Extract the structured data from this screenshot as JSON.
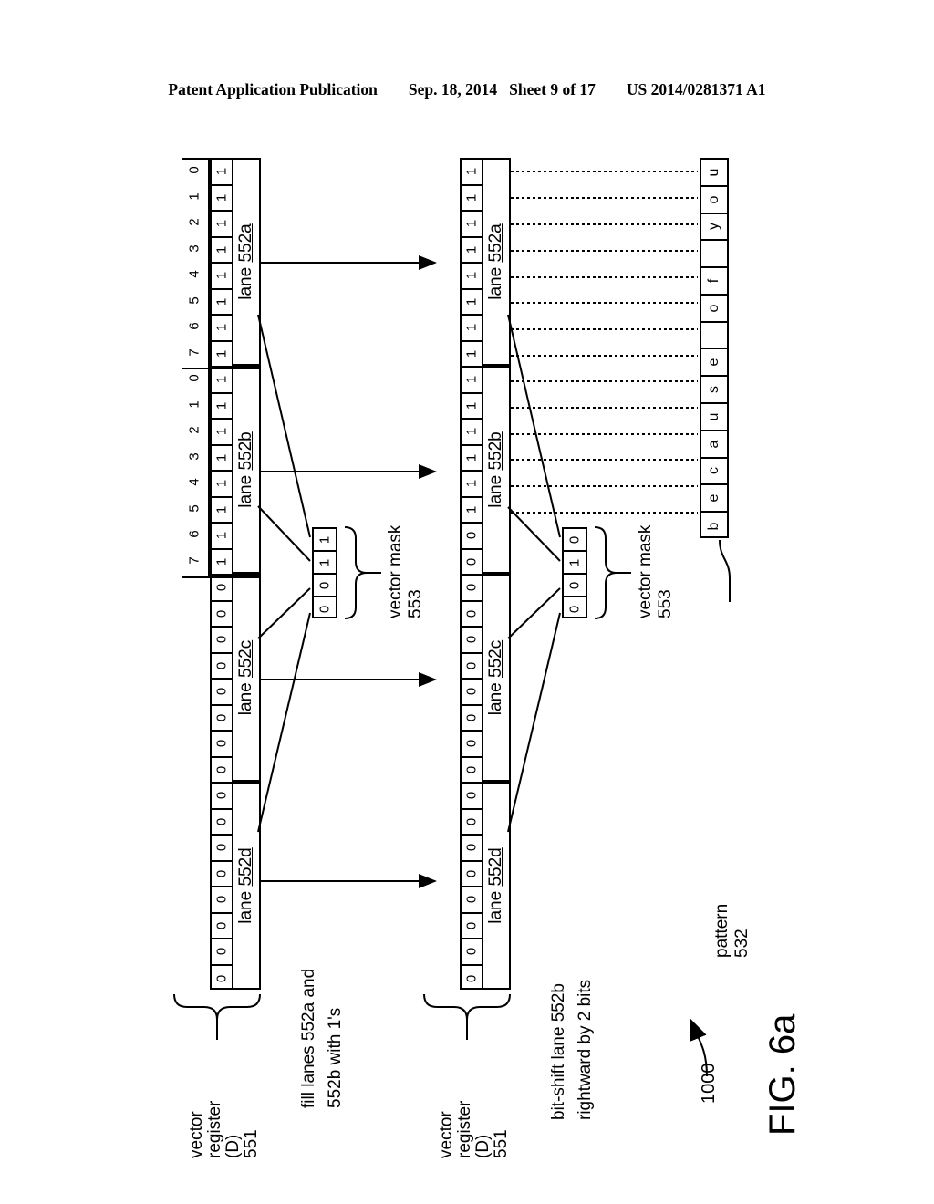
{
  "header": {
    "publication": "Patent Application Publication",
    "date": "Sep. 18, 2014",
    "sheet": "Sheet 9 of 17",
    "patent_number": "US 2014/0281371 A1"
  },
  "figure": {
    "label": "FIG. 6a",
    "reference_numeral": "1000"
  },
  "bit_indices": [
    "0",
    "1",
    "2",
    "3",
    "4",
    "5",
    "6",
    "7"
  ],
  "left_register": {
    "name": "vector register (D) 551",
    "label_lines": [
      "vector",
      "register",
      "(D)",
      "551"
    ],
    "operation_caption": [
      "fill lanes 552a and",
      "552b with 1's"
    ],
    "lanes": [
      {
        "label_prefix": "lane ",
        "label_ref": "552a",
        "bits": [
          "1",
          "1",
          "1",
          "1",
          "1",
          "1",
          "1",
          "1"
        ],
        "indexed": true
      },
      {
        "label_prefix": "lane ",
        "label_ref": "552b",
        "bits": [
          "1",
          "1",
          "1",
          "1",
          "1",
          "1",
          "1",
          "1"
        ],
        "indexed": true
      },
      {
        "label_prefix": "lane ",
        "label_ref": "552c",
        "bits": [
          "0",
          "0",
          "0",
          "0",
          "0",
          "0",
          "0",
          "0"
        ],
        "indexed": false
      },
      {
        "label_prefix": "lane ",
        "label_ref": "552d",
        "bits": [
          "0",
          "0",
          "0",
          "0",
          "0",
          "0",
          "0",
          "0"
        ],
        "indexed": false
      }
    ],
    "mask": {
      "label_lines": [
        "vector mask",
        "553"
      ],
      "bits": [
        "1",
        "1",
        "0",
        "0"
      ]
    }
  },
  "right_register": {
    "name": "vector register (D) 551",
    "label_lines": [
      "vector",
      "register",
      "(D)",
      "551"
    ],
    "operation_caption": [
      "bit-shift lane 552b",
      "rightward by 2 bits"
    ],
    "lanes": [
      {
        "label_prefix": "lane ",
        "label_ref": "552a",
        "bits": [
          "1",
          "1",
          "1",
          "1",
          "1",
          "1",
          "1",
          "1"
        ],
        "indexed": false
      },
      {
        "label_prefix": "lane ",
        "label_ref": "552b",
        "bits": [
          "1",
          "1",
          "1",
          "1",
          "1",
          "1",
          "0",
          "0"
        ],
        "indexed": false
      },
      {
        "label_prefix": "lane ",
        "label_ref": "552c",
        "bits": [
          "0",
          "0",
          "0",
          "0",
          "0",
          "0",
          "0",
          "0"
        ],
        "indexed": false
      },
      {
        "label_prefix": "lane ",
        "label_ref": "552d",
        "bits": [
          "0",
          "0",
          "0",
          "0",
          "0",
          "0",
          "0",
          "0"
        ],
        "indexed": false
      }
    ],
    "mask": {
      "label_lines": [
        "vector mask",
        "553"
      ],
      "bits": [
        "0",
        "1",
        "0",
        "0"
      ]
    }
  },
  "pattern": {
    "label_lines": [
      "pattern",
      "532"
    ],
    "characters": [
      "u",
      "o",
      "y",
      " ",
      "f",
      "o",
      " ",
      "e",
      "s",
      "u",
      "a",
      "c",
      "e",
      "b"
    ],
    "reading": "because of you"
  }
}
